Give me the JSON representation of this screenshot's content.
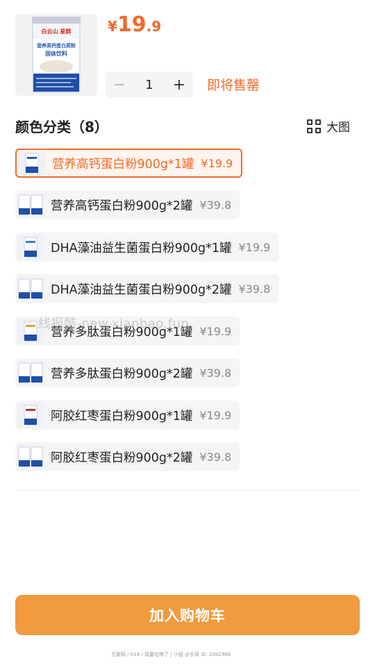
{
  "product": {
    "price_currency": "¥",
    "price_integer": "19",
    "price_decimal": ".9",
    "quantity": "1",
    "minus_symbol": "−",
    "plus_symbol": "+",
    "stock_status": "即将售罄",
    "thumb_brand": "白云山 星群",
    "thumb_title": "营养高钙蛋白质粉",
    "thumb_subtitle": "固体饮料"
  },
  "variants": {
    "section_title": "颜色分类（8）",
    "view_label": "大图",
    "items": [
      {
        "name": "营养高钙蛋白粉900g*1罐",
        "price": "¥19.9",
        "selected": true
      },
      {
        "name": "营养高钙蛋白粉900g*2罐",
        "price": "¥39.8",
        "selected": false
      },
      {
        "name": "DHA藻油益生菌蛋白粉900g*1罐",
        "price": "¥19.9",
        "selected": false
      },
      {
        "name": "DHA藻油益生菌蛋白粉900g*2罐",
        "price": "¥39.8",
        "selected": false
      },
      {
        "name": "营养多肽蛋白粉900g*1罐",
        "price": "¥19.9",
        "selected": false
      },
      {
        "name": "营养多肽蛋白粉900g*2罐",
        "price": "¥39.8",
        "selected": false
      },
      {
        "name": "阿胶红枣蛋白粉900g*1罐",
        "price": "¥19.9",
        "selected": false
      },
      {
        "name": "阿胶红枣蛋白粉900g*2罐",
        "price": "¥39.8",
        "selected": false
      }
    ]
  },
  "actions": {
    "add_to_cart": "加入购物车"
  },
  "watermark": "线报酷-new.xianbao.fun",
  "footer_note": "互联网 / 618 / 我要吃撑了 | 小组 @东哥 ID: 2042986"
}
